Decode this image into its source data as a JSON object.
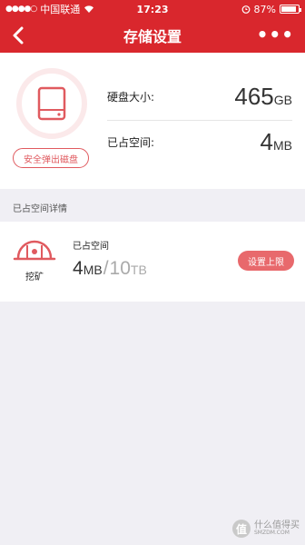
{
  "status_bar": {
    "signal_dots": "●●●●○",
    "carrier": "中国联通",
    "wifi_icon": "wifi-icon",
    "time": "17:23",
    "battery_percent": "87%",
    "battery_level": 0.87
  },
  "nav": {
    "back_icon": "chevron-left-icon",
    "title": "存储设置",
    "more_icon": "more-dots-icon"
  },
  "storage": {
    "disk_icon": "hard-disk-icon",
    "eject_label": "安全弹出磁盘",
    "size_label": "硬盘大小:",
    "size_value": "465",
    "size_unit": "GB",
    "used_label": "已占空间:",
    "used_value": "4",
    "used_unit": "MB"
  },
  "details": {
    "header": "已占空间详情",
    "item": {
      "icon": "mining-helmet-icon",
      "name": "挖矿",
      "used_label": "已占空间",
      "used_value": "4",
      "used_unit": "MB",
      "separator": "/",
      "limit_value": "10",
      "limit_unit": "TB",
      "set_limit_label": "设置上限"
    }
  },
  "watermark": {
    "logo": "值",
    "line1": "什么值得买",
    "line2": "SMZDM.COM"
  },
  "colors": {
    "brand_red": "#d9272d",
    "button_red": "#e8696c",
    "background": "#f0eff4"
  }
}
